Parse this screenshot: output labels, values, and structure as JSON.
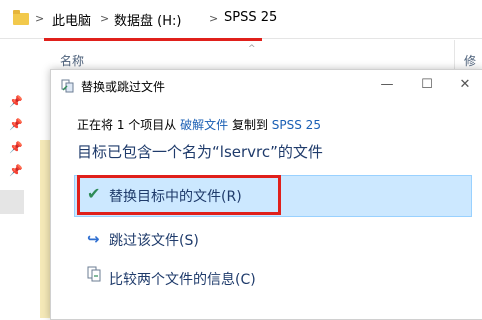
{
  "explorer": {
    "breadcrumb": [
      "此电脑",
      "数据盘 (H:)",
      "SPSS 25"
    ],
    "separator": ">",
    "column_name": "名称",
    "column_right": "修",
    "sort_caret": "^"
  },
  "dialog": {
    "title": "替换或跳过文件",
    "controls": {
      "minimize": "—",
      "maximize": "☐",
      "close": "✕"
    },
    "info": {
      "prefix": "正在将 1 个项目从",
      "source": "破解文件",
      "middle": "复制到",
      "destination": "SPSS 25"
    },
    "heading": "目标已包含一个名为“lservrc”的文件",
    "options": [
      {
        "label": "替换目标中的文件(R)",
        "icon": "checkmark-icon",
        "selected": true
      },
      {
        "label": "跳过该文件(S)",
        "icon": "skip-arrow-icon"
      },
      {
        "label": "比较两个文件的信息(C)",
        "icon": "compare-files-icon"
      }
    ]
  },
  "colors": {
    "accent": "#1a5fb4",
    "highlight": "#cce8ff",
    "annotation_red": "#e0201b",
    "check_green": "#2e8b57"
  }
}
